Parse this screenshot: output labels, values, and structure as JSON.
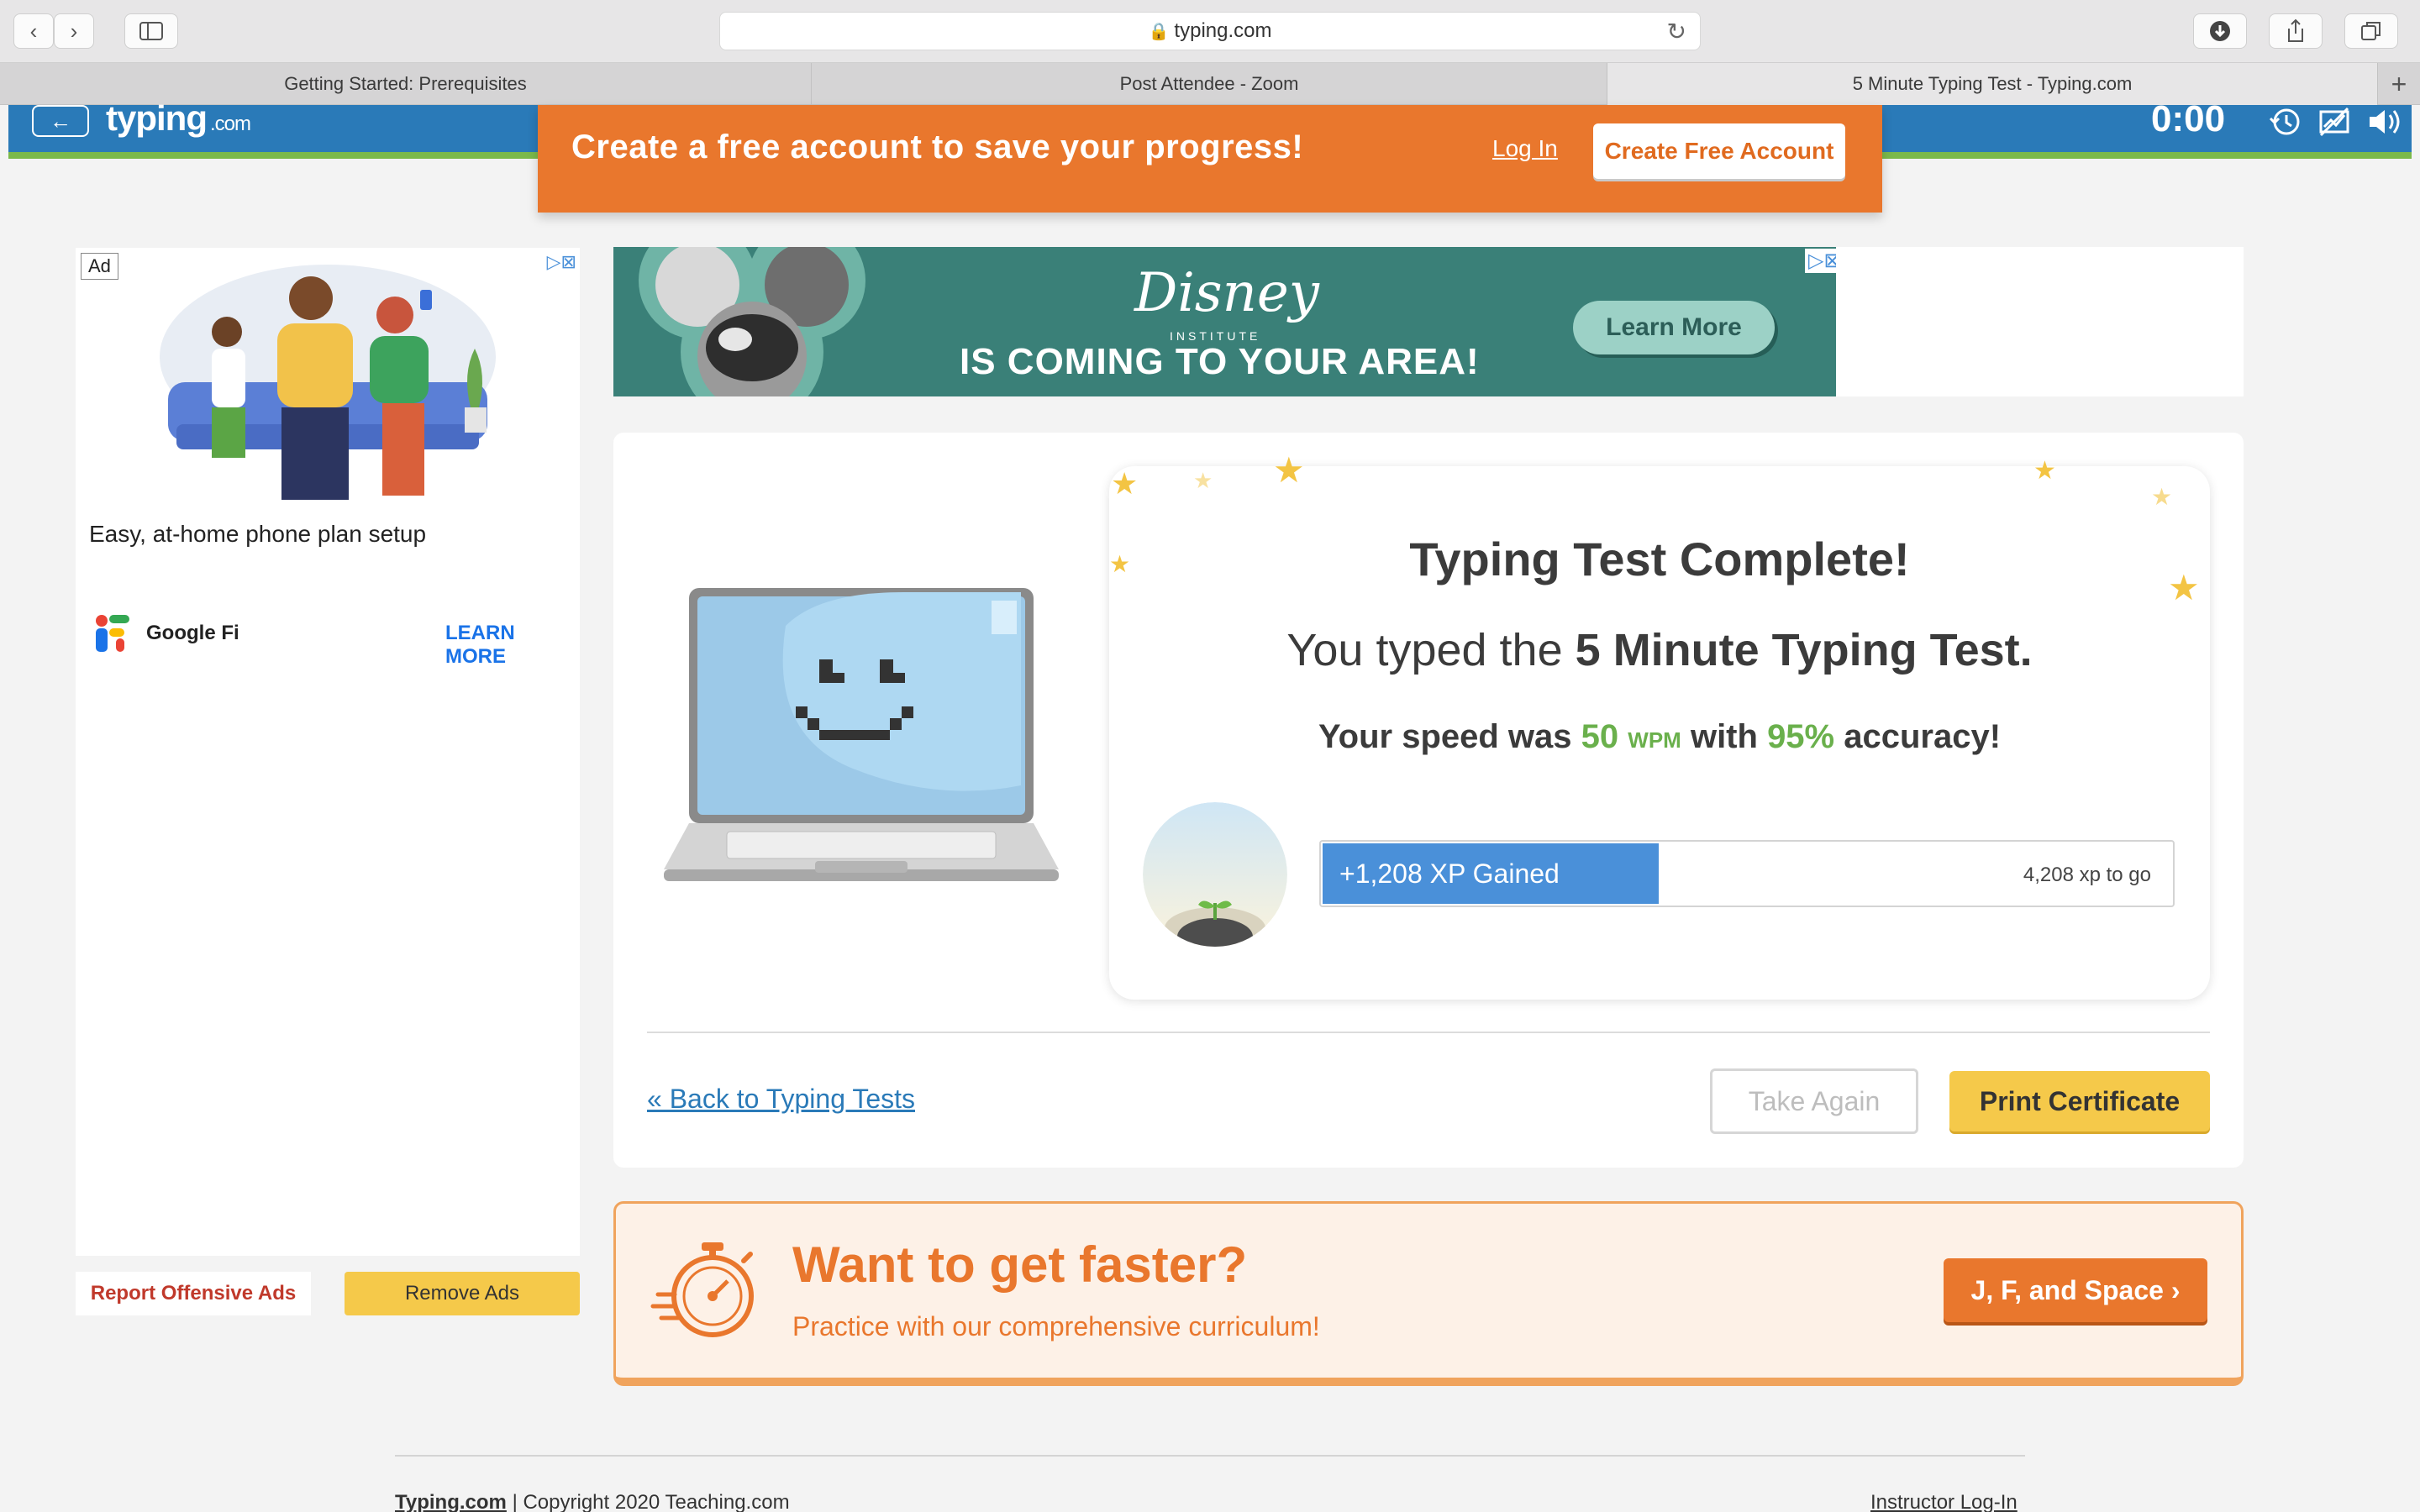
{
  "browser": {
    "url": "typing.com",
    "tabs": [
      {
        "label": "Getting Started: Prerequisites"
      },
      {
        "label": "Post Attendee - Zoom"
      },
      {
        "label": "5 Minute Typing Test - Typing.com"
      }
    ]
  },
  "site_header": {
    "logo_text": "typing",
    "logo_suffix": ".com",
    "timer": "0:00"
  },
  "banner": {
    "text": "Create a free account to save your progress!",
    "login": "Log In",
    "create": "Create Free Account"
  },
  "left_ad": {
    "label": "Ad",
    "headline": "Easy, at-home phone plan setup",
    "advertiser": "Google Fi",
    "cta": "LEARN MORE",
    "report": "Report Offensive Ads",
    "remove": "Remove Ads"
  },
  "top_ad": {
    "brand": "Disney",
    "sub": "INSTITUTE",
    "tagline": "IS COMING TO YOUR AREA!",
    "cta": "Learn More"
  },
  "results": {
    "title": "Typing Test Complete!",
    "typed_prefix": "You typed the",
    "test_name": "5 Minute Typing Test.",
    "speed_prefix": "Your speed was",
    "wpm_value": "50",
    "wpm_unit": "WPM",
    "with": "with",
    "accuracy": "95%",
    "accuracy_suffix": "accuracy!",
    "xp_gained": "+1,208 XP Gained",
    "xp_to_go": "4,208 xp to go",
    "back_link": "« Back to Typing Tests",
    "take_again": "Take Again",
    "print_certificate": "Print Certificate"
  },
  "faster": {
    "title": "Want to get faster?",
    "subtitle": "Practice with our comprehensive curriculum!",
    "cta": "J, F, and Space ›"
  },
  "footer": {
    "brand": "Typing.com",
    "copyright": "Copyright 2020",
    "company": "Teaching.com",
    "instructor": "Instructor Log-In"
  },
  "colors": {
    "header_blue": "#2a7ab8",
    "orange": "#e9772d",
    "green": "#6ab04c",
    "yellow": "#f5c94a",
    "xp_blue": "#4a90d9"
  }
}
